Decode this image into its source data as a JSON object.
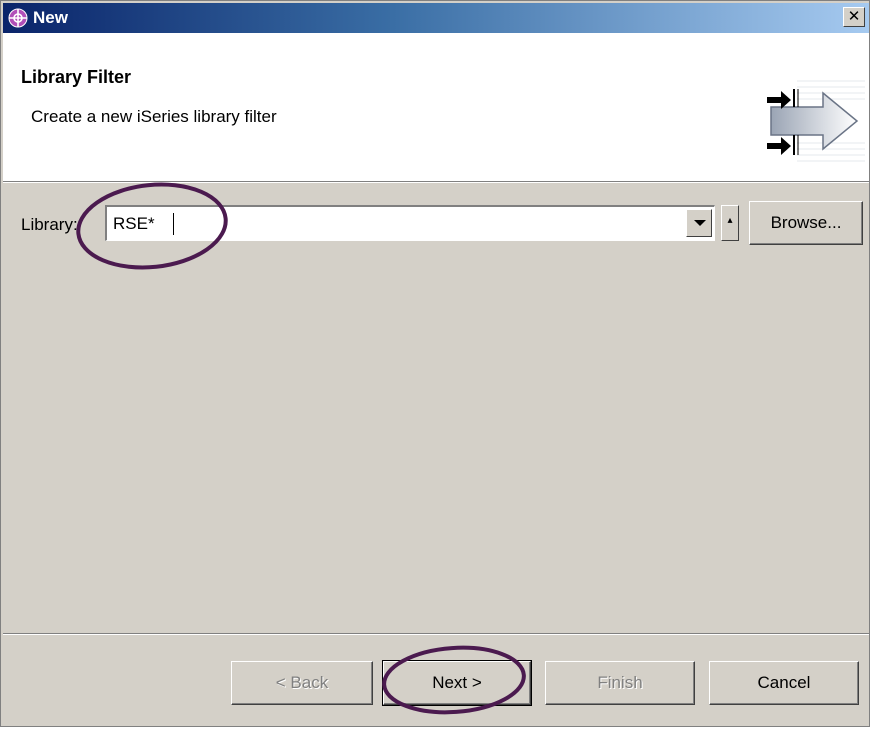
{
  "window": {
    "title": "New",
    "close_glyph": "✕",
    "app_icon": "eclipse-crosshair-icon"
  },
  "banner": {
    "title": "Library Filter",
    "description": "Create a new iSeries library filter",
    "graphic": "wizard-arrows-icon"
  },
  "library": {
    "label": "Library:",
    "value": "RSE*",
    "browse_label": "Browse..."
  },
  "footer": {
    "back_label": "< Back",
    "next_label": "Next >",
    "finish_label": "Finish",
    "cancel_label": "Cancel"
  },
  "colors": {
    "title_gradient_start": "#0a246a",
    "title_gradient_end": "#a6caf0",
    "dialog_face": "#d4d0c8",
    "annotation": "#4b1a4f"
  }
}
